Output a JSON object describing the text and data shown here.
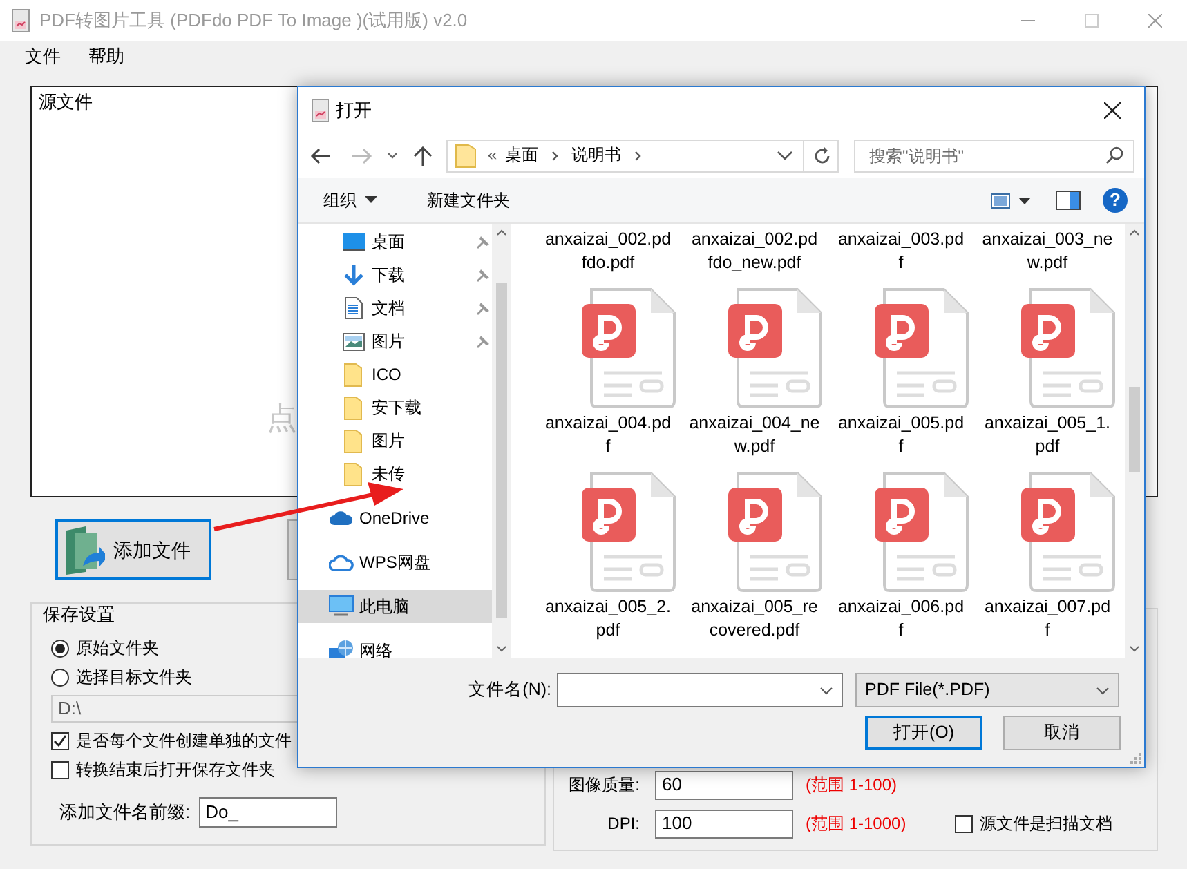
{
  "window": {
    "title": "PDF转图片工具 (PDFdo PDF To Image )(试用版) v2.0"
  },
  "menu": [
    {
      "label": "文件"
    },
    {
      "label": "帮助"
    }
  ],
  "source_panel": {
    "label": "源文件",
    "hint": "点"
  },
  "add_button": {
    "label": "添加文件"
  },
  "save_settings": {
    "title": "保存设置",
    "options": [
      {
        "label": "原始文件夹",
        "selected": true
      },
      {
        "label": "选择目标文件夹",
        "selected": false
      }
    ],
    "path": {
      "value": "D:\\",
      "disabled": true
    },
    "checkboxes": [
      {
        "label": "是否每个文件创建单独的文件",
        "checked": true
      },
      {
        "label": "转换结束后打开保存文件夹",
        "checked": false
      }
    ],
    "prefix": {
      "label": "添加文件名前缀:",
      "value": "Do_"
    }
  },
  "image_settings": {
    "fields": [
      {
        "label": "图像质量:",
        "value": "60",
        "range": "(范围 1-100)"
      },
      {
        "label": "DPI:",
        "value": "100",
        "range": "(范围 1-1000)"
      }
    ],
    "scanned": {
      "label": "源文件是扫描文档",
      "checked": false
    }
  },
  "dialog": {
    "title": "打开",
    "address": {
      "overflow": "«",
      "crumbs": [
        "桌面",
        "说明书"
      ]
    },
    "search": {
      "placeholder": "搜索\"说明书\""
    },
    "toolbar": {
      "organize": "组织",
      "new_folder": "新建文件夹",
      "help": "?"
    },
    "nav_sections": [
      {
        "items": [
          {
            "label": "桌面",
            "kind": "desktop",
            "pinned": true,
            "selected": false
          },
          {
            "label": "下载",
            "kind": "download",
            "pinned": true,
            "selected": false
          },
          {
            "label": "文档",
            "kind": "document",
            "pinned": true,
            "selected": false
          },
          {
            "label": "图片",
            "kind": "pictures",
            "pinned": true,
            "selected": false
          },
          {
            "label": "ICO",
            "kind": "folder",
            "pinned": false,
            "selected": false
          },
          {
            "label": "安下载",
            "kind": "folder",
            "pinned": false,
            "selected": false
          },
          {
            "label": "图片",
            "kind": "folder",
            "pinned": false,
            "selected": false
          },
          {
            "label": "未传",
            "kind": "folder",
            "pinned": false,
            "selected": false
          }
        ]
      },
      {
        "items": [
          {
            "label": "OneDrive",
            "kind": "cloud",
            "pinned": false,
            "selected": false
          },
          {
            "label": "WPS网盘",
            "kind": "cloud_outline",
            "pinned": false,
            "selected": false
          },
          {
            "label": "此电脑",
            "kind": "computer",
            "pinned": false,
            "selected": true
          },
          {
            "label": "网络",
            "kind": "network",
            "pinned": false,
            "selected": false
          }
        ]
      }
    ],
    "files": [
      {
        "lines": [
          "anxaizai_002.pd",
          "fdo.pdf"
        ],
        "kind": "label_only"
      },
      {
        "lines": [
          "anxaizai_002.pd",
          "fdo_new.pdf"
        ],
        "kind": "label_only"
      },
      {
        "lines": [
          "anxaizai_003.pd",
          "f"
        ],
        "kind": "label_only"
      },
      {
        "lines": [
          "anxaizai_003_ne",
          "w.pdf"
        ],
        "kind": "label_only"
      },
      {
        "lines": [
          "anxaizai_004.pd",
          "f"
        ],
        "kind": "pdf"
      },
      {
        "lines": [
          "anxaizai_004_ne",
          "w.pdf"
        ],
        "kind": "pdf"
      },
      {
        "lines": [
          "anxaizai_005.pd",
          "f"
        ],
        "kind": "pdf"
      },
      {
        "lines": [
          "anxaizai_005_1.",
          "pdf"
        ],
        "kind": "pdf"
      },
      {
        "lines": [
          "anxaizai_005_2.",
          "pdf"
        ],
        "kind": "pdf"
      },
      {
        "lines": [
          "anxaizai_005_re",
          "covered.pdf"
        ],
        "kind": "pdf"
      },
      {
        "lines": [
          "anxaizai_006.pd",
          "f"
        ],
        "kind": "pdf"
      },
      {
        "lines": [
          "anxaizai_007.pd",
          "f"
        ],
        "kind": "pdf"
      }
    ],
    "file_name": {
      "label": "文件名(N):"
    },
    "file_type": {
      "value": "PDF File(*.PDF)"
    },
    "buttons": [
      {
        "label": "打开(O)",
        "default": true
      },
      {
        "label": "取消",
        "default": false
      }
    ]
  }
}
